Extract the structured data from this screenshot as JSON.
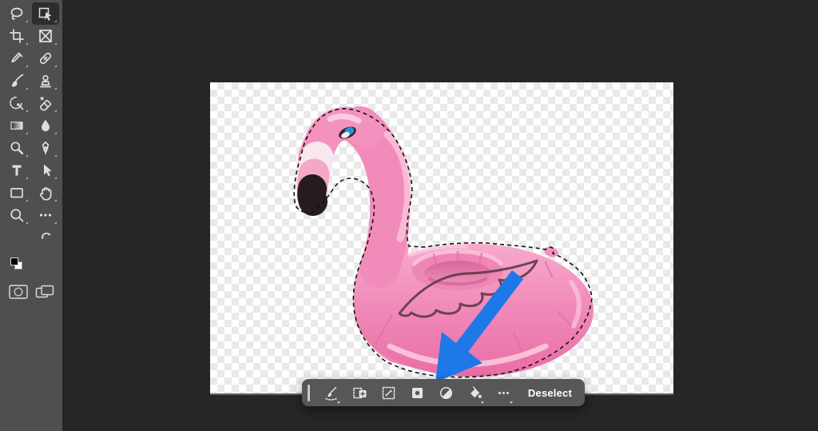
{
  "window": {
    "background_color": "#262626",
    "description": "Photo editor workspace with tool bar, transparent canvas, selected flamingo float and contextual task bar"
  },
  "toolbar": {
    "background_color": "#4f4f4f",
    "active_tool": "object-selection",
    "tools": [
      {
        "name": "lasso"
      },
      {
        "name": "object-selection"
      },
      {
        "name": "crop"
      },
      {
        "name": "frame"
      },
      {
        "name": "eyedropper"
      },
      {
        "name": "spot-healing"
      },
      {
        "name": "brush"
      },
      {
        "name": "clone-stamp"
      },
      {
        "name": "history-brush"
      },
      {
        "name": "eraser"
      },
      {
        "name": "gradient"
      },
      {
        "name": "blur"
      },
      {
        "name": "dodge"
      },
      {
        "name": "pen"
      },
      {
        "name": "type"
      },
      {
        "name": "path-selection"
      },
      {
        "name": "rectangle"
      },
      {
        "name": "hand"
      },
      {
        "name": "zoom"
      },
      {
        "name": "more-tools"
      }
    ],
    "colors": {
      "foreground": "#000000",
      "background": "#ffffff"
    },
    "extras": [
      {
        "name": "swap-colors"
      },
      {
        "name": "default-colors"
      },
      {
        "name": "quick-mask-mode"
      },
      {
        "name": "screen-mode"
      }
    ]
  },
  "canvas": {
    "content": "inflatable pink flamingo cup-holder pool float on transparent checkerboard",
    "selection_active": true,
    "selection_style": "marching-ants",
    "flamingo_colors": {
      "body_pink": "#f18cba",
      "highlight_pink": "#fbc9de",
      "shadow_pink": "#e06fa4",
      "beak_black": "#251b21",
      "band_white": "#f9e7ee",
      "band_light_pink": "#f4a7c7",
      "eye_blue": "#2196d8",
      "wing_outline": "#5d3b45"
    }
  },
  "taskbar": {
    "background_color": "#575757",
    "buttons": [
      {
        "name": "selection-brush"
      },
      {
        "name": "modify-selection"
      },
      {
        "name": "transform-selection"
      },
      {
        "name": "create-mask"
      },
      {
        "name": "adjustment-layer"
      },
      {
        "name": "fill-selection"
      },
      {
        "name": "more-options"
      }
    ],
    "deselect_label": "Deselect"
  },
  "annotation_arrow": {
    "color": "#1e78e8",
    "points_to": "create-mask-button"
  }
}
